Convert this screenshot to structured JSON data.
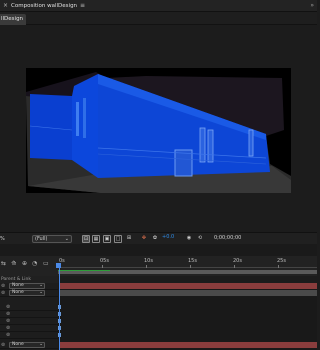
{
  "composition": {
    "panel_title": "Composition wallDesign",
    "tab_label": "llDesign"
  },
  "viewer": {
    "zoom_label": "%",
    "resolution": "(Full)",
    "exposure": "+0.0",
    "timecode": "0;00;00;00"
  },
  "timeline": {
    "ruler_labels": [
      "0s",
      "05s",
      "10s",
      "15s",
      "20s",
      "25s"
    ],
    "column_header": "Parent & Link",
    "layers": [
      {
        "parent": "None",
        "bar": "red"
      },
      {
        "parent": "None",
        "bar": "grey"
      },
      {
        "parent": "",
        "bar": "none"
      },
      {
        "parent": "",
        "bar": "none"
      },
      {
        "parent": "",
        "bar": "none"
      },
      {
        "parent": "",
        "bar": "none"
      },
      {
        "parent": "",
        "bar": "none"
      },
      {
        "parent": "None",
        "bar": "red"
      }
    ]
  },
  "colors": {
    "accent_blue": "#4b8ae8",
    "layer_red": "#8a3d3d",
    "wall_blue": "#0a3fd0",
    "workarea_green": "#2e9d3a"
  }
}
